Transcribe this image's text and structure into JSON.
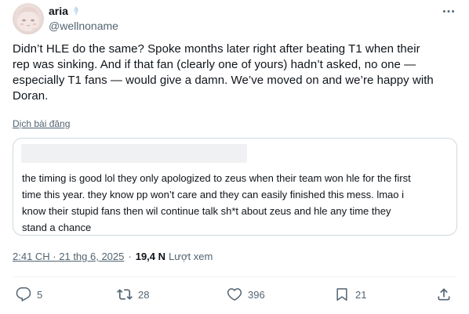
{
  "author": {
    "display_name": "aria",
    "handle": "@wellnoname"
  },
  "tweet": {
    "lines": [
      "Didn’t HLE do the same? Spoke months later right after beating T1 when their",
      "rep was sinking. And if that fan (clearly one of yours) hadn’t asked, no one —",
      "especially T1 fans — would give a damn. We’ve moved on and we’re happy with",
      "Doran."
    ],
    "translate_label": "Dịch bài đăng"
  },
  "quote": {
    "lines": [
      "the timing is good lol they only apologized to zeus when their team won hle for the first",
      "time this year. they know pp won’t care and they can easily finished this mess. lmao i",
      "know their stupid fans then wil continue talk sh*t about zeus and hle any time they",
      "stand a chance"
    ]
  },
  "meta": {
    "timestamp": "2:41 CH · 21 thg 6, 2025",
    "separator": "·",
    "views_count": "19,4 N",
    "views_label": "Lượt xem"
  },
  "actions": {
    "replies": "5",
    "retweets": "28",
    "likes": "396",
    "bookmarks": "21"
  },
  "colors": {
    "text_primary": "#0f1419",
    "text_secondary": "#536471",
    "border": "#cfd9de",
    "divider": "#eff3f4"
  },
  "icons": {
    "more": "more-dots-icon",
    "reply": "reply-bubble-icon",
    "retweet": "retweet-arrows-icon",
    "like": "heart-icon",
    "bookmark": "bookmark-icon",
    "share": "share-upload-icon"
  }
}
